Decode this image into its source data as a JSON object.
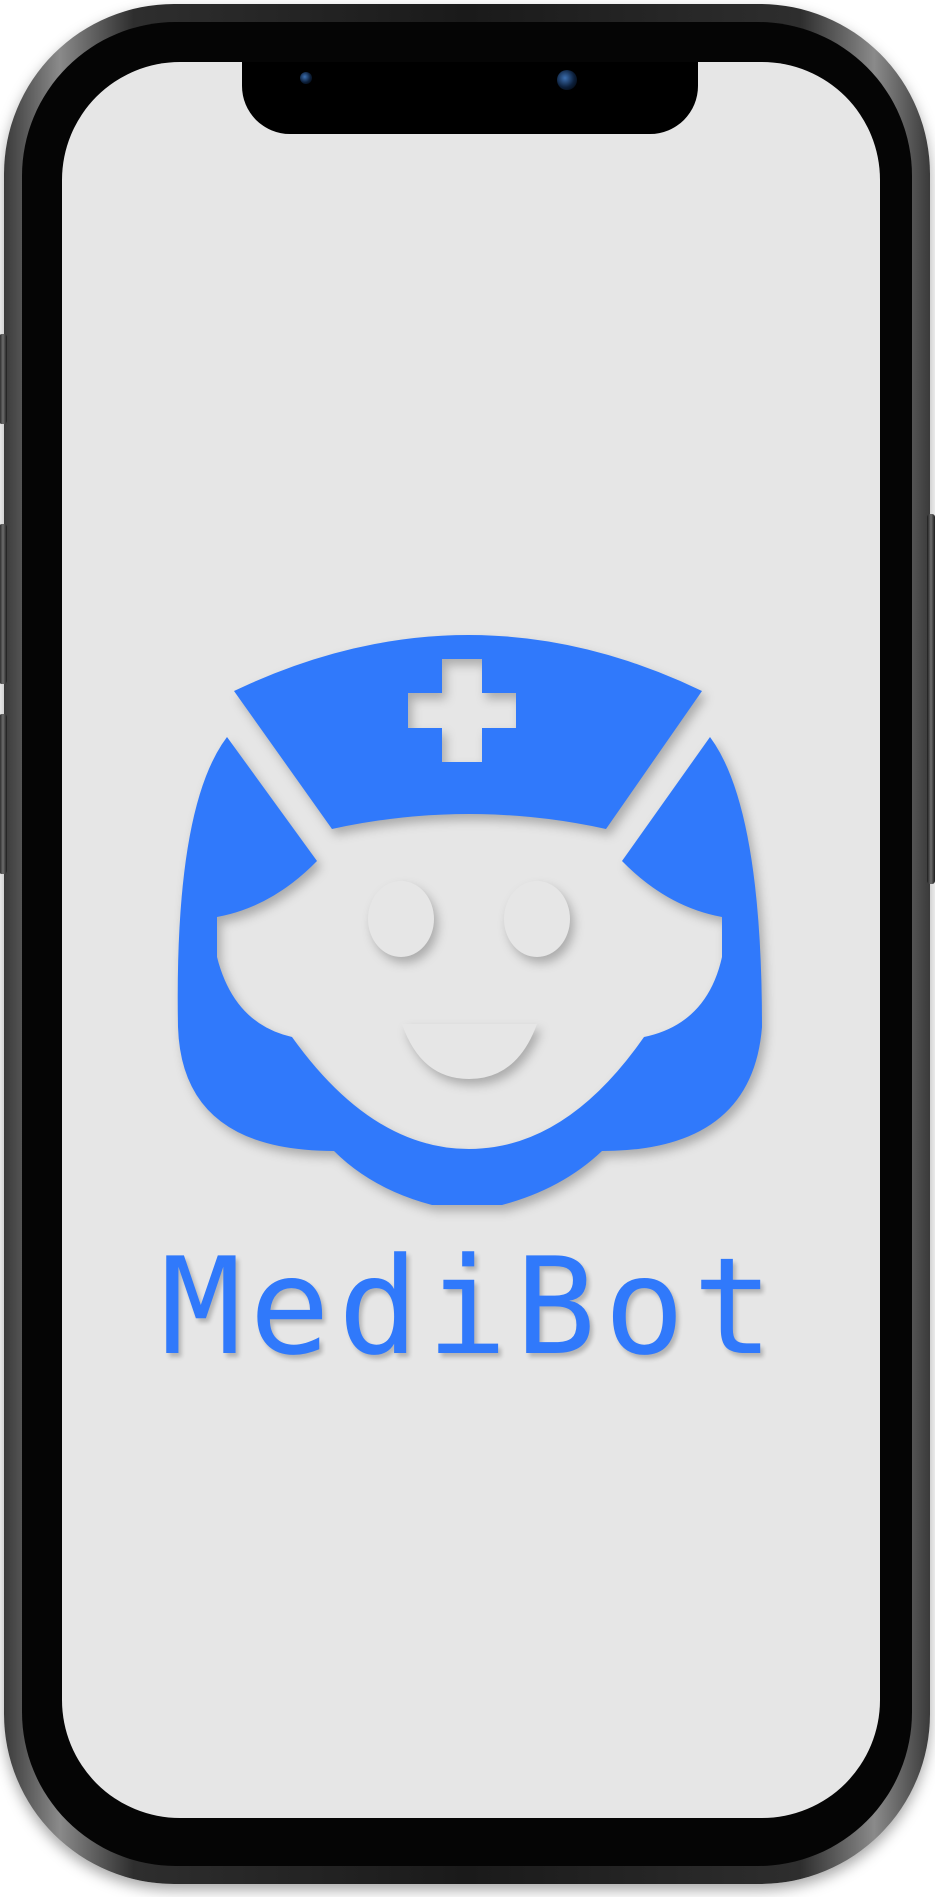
{
  "app": {
    "name": "MediBot"
  },
  "logo": {
    "icon": "nurse-robot-icon",
    "color": "#3079fb"
  },
  "screen": {
    "background": "#e6e6e6"
  }
}
